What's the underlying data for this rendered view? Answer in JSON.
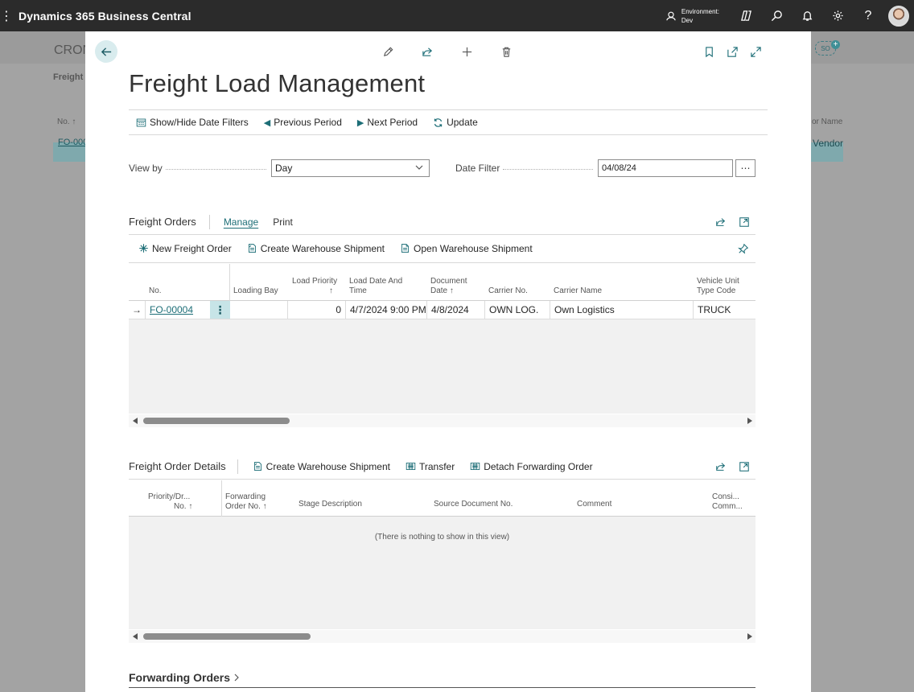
{
  "app": {
    "title": "Dynamics 365 Business Central",
    "environment_label": "Environment:",
    "environment_value": "Dev"
  },
  "background": {
    "title_fragment": "CRON",
    "sub_fragment": "Freight (",
    "col_no": "No. ↑",
    "col_vendor": "or Name",
    "row_no": "FO-000",
    "row_vendor": "Vendor",
    "badge": "SO"
  },
  "page": {
    "title": "Freight Load Management"
  },
  "actions": {
    "show_hide": "Show/Hide Date Filters",
    "previous": "Previous Period",
    "next": "Next Period",
    "update": "Update"
  },
  "fields": {
    "view_by_label": "View by",
    "view_by_value": "Day",
    "date_filter_label": "Date Filter",
    "date_filter_value": "04/08/24",
    "ellipsis": "⋯"
  },
  "freight_orders": {
    "title": "Freight Orders",
    "tabs": [
      "Manage",
      "Print"
    ],
    "actions": {
      "new": "New Freight Order",
      "create_shipment": "Create Warehouse Shipment",
      "open_shipment": "Open Warehouse Shipment"
    },
    "columns": {
      "no": "No.",
      "loading_bay": "Loading Bay",
      "load_priority_1": "Load Priority",
      "load_priority_2": "↑",
      "load_date_1": "Load Date And",
      "load_date_2": "Time",
      "doc_date_1": "Document",
      "doc_date_2": "Date ↑",
      "carrier_no": "Carrier No.",
      "carrier_name": "Carrier Name",
      "vehicle_1": "Vehicle Unit",
      "vehicle_2": "Type Code"
    },
    "rows": [
      {
        "no": "FO-00004",
        "loading_bay": "",
        "load_priority": "0",
        "load_date": "4/7/2024 9:00 PM",
        "doc_date": "4/8/2024",
        "carrier_no": "OWN LOG.",
        "carrier_name": "Own Logistics",
        "vehicle": "TRUCK"
      }
    ]
  },
  "details": {
    "title": "Freight Order Details",
    "actions": {
      "create_shipment": "Create Warehouse Shipment",
      "transfer": "Transfer",
      "detach": "Detach Forwarding Order"
    },
    "columns": {
      "priority_1": "Priority/Dr...",
      "priority_2": "No. ↑",
      "fwd_1": "Forwarding",
      "fwd_2": "Order No. ↑",
      "stage": "Stage Description",
      "source_doc": "Source Document No.",
      "comment": "Comment",
      "consi_1": "Consi...",
      "consi_2": "Comm..."
    },
    "empty_message": "(There is nothing to show in this view)"
  },
  "forwarding_orders": {
    "title": "Forwarding Orders"
  },
  "colors": {
    "accent": "#1d6e77",
    "topbar": "#2b2b2b",
    "selected_cell": "#c7e4e7"
  }
}
